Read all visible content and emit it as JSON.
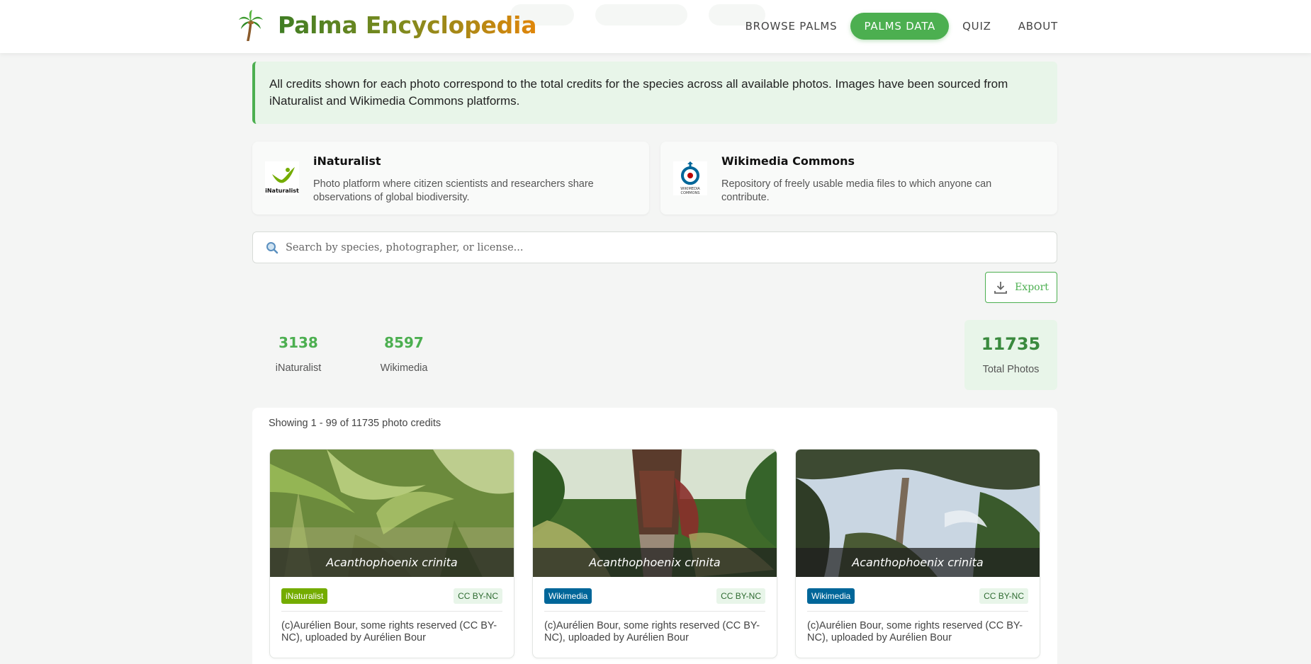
{
  "header": {
    "brand": "Palma Encyclopedia",
    "logo_icon": "palm-tree-icon",
    "nav": [
      {
        "label": "BROWSE PALMS",
        "active": false
      },
      {
        "label": "PALMS DATA",
        "active": true
      },
      {
        "label": "QUIZ",
        "active": false
      },
      {
        "label": "ABOUT",
        "active": false
      }
    ]
  },
  "banner": {
    "text": "All credits shown for each photo correspond to the total credits for the species across all available photos. Images have been sourced from iNaturalist and Wikimedia Commons platforms."
  },
  "sources": [
    {
      "title": "iNaturalist",
      "description": "Photo platform where citizen scientists and researchers share observations of global biodiversity.",
      "icon": "inaturalist-logo"
    },
    {
      "title": "Wikimedia Commons",
      "description": "Repository of freely usable media files to which anyone can contribute.",
      "icon": "wikimedia-commons-logo"
    }
  ],
  "search": {
    "placeholder": "Search by species, photographer, or license...",
    "value": ""
  },
  "export": {
    "label": "Export",
    "icon": "download-icon"
  },
  "stats": {
    "inaturalist": {
      "value": "3138",
      "label": "iNaturalist"
    },
    "wikimedia": {
      "value": "8597",
      "label": "Wikimedia"
    },
    "total": {
      "value": "11735",
      "label": "Total Photos"
    }
  },
  "gallery": {
    "showing": "Showing 1 - 99 of 11735 photo credits",
    "cards": [
      {
        "species": "Acanthophoenix crinita",
        "source": "iNaturalist",
        "source_color": "#74ac00",
        "license": "CC BY-NC",
        "credit": "(c)Aurélien Bour, some rights reserved (CC BY-NC), uploaded by Aurélien Bour"
      },
      {
        "species": "Acanthophoenix crinita",
        "source": "Wikimedia",
        "source_color": "#006699",
        "license": "CC BY-NC",
        "credit": "(c)Aurélien Bour, some rights reserved (CC BY-NC), uploaded by Aurélien Bour"
      },
      {
        "species": "Acanthophoenix crinita",
        "source": "Wikimedia",
        "source_color": "#006699",
        "license": "CC BY-NC",
        "credit": "(c)Aurélien Bour, some rights reserved (CC BY-NC), uploaded by Aurélien Bour"
      }
    ]
  }
}
